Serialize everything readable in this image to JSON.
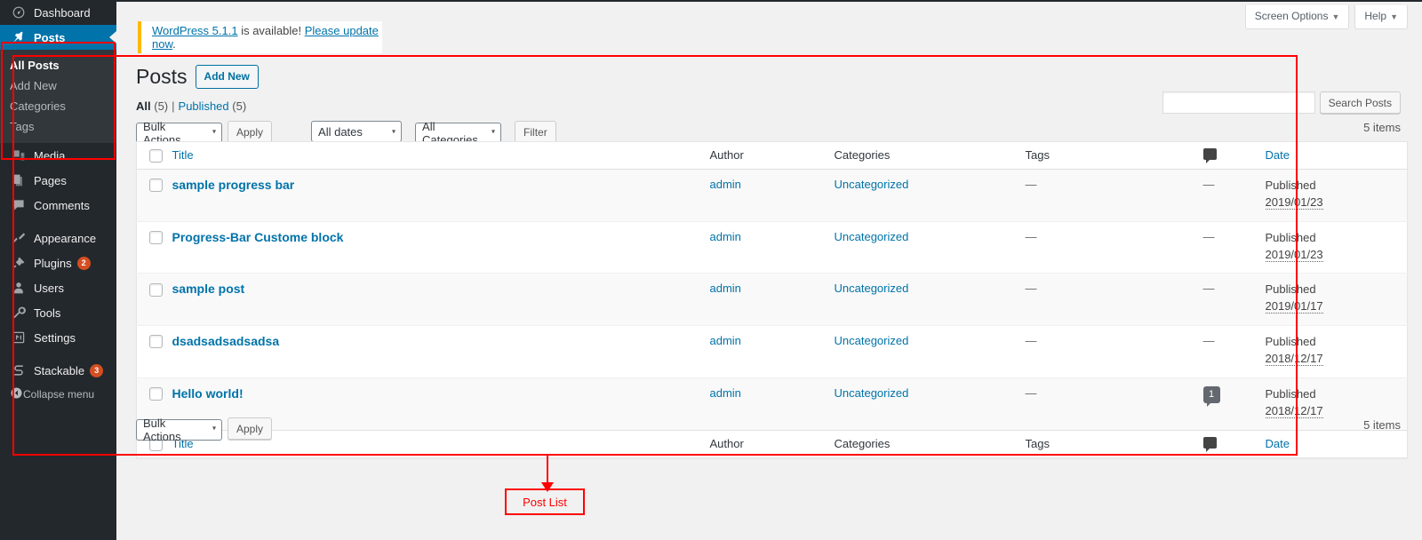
{
  "sidebar": {
    "items": [
      {
        "label": "Dashboard",
        "icon": "dashboard-icon",
        "current": false
      },
      {
        "label": "Posts",
        "icon": "pin-icon",
        "current": true
      },
      {
        "label": "Media",
        "icon": "media-icon",
        "current": false
      },
      {
        "label": "Pages",
        "icon": "pages-icon",
        "current": false
      },
      {
        "label": "Comments",
        "icon": "comments-icon",
        "current": false
      },
      {
        "label": "Appearance",
        "icon": "brush-icon",
        "current": false
      },
      {
        "label": "Plugins",
        "icon": "plugin-icon",
        "current": false,
        "badge": "2"
      },
      {
        "label": "Users",
        "icon": "user-icon",
        "current": false
      },
      {
        "label": "Tools",
        "icon": "wrench-icon",
        "current": false
      },
      {
        "label": "Settings",
        "icon": "settings-icon",
        "current": false
      },
      {
        "label": "Stackable",
        "icon": "stackable-icon",
        "current": false,
        "badge": "3"
      }
    ],
    "submenu": [
      {
        "label": "All Posts",
        "current": true
      },
      {
        "label": "Add New",
        "current": false
      },
      {
        "label": "Categories",
        "current": false
      },
      {
        "label": "Tags",
        "current": false
      }
    ],
    "collapse": {
      "label": "Collapse menu",
      "icon": "collapse-icon"
    }
  },
  "screen_meta": {
    "screen_options": "Screen Options",
    "help": "Help",
    "caret": "▼"
  },
  "notice": {
    "link_version": "WordPress 5.1.1",
    "middle": " is available! ",
    "link_update": "Please update now",
    "end": "."
  },
  "header": {
    "title": "Posts",
    "add_new": "Add New"
  },
  "views": {
    "all_label": "All",
    "all_count": "(5)",
    "divider": "|",
    "published_label": "Published",
    "published_count": "(5)"
  },
  "search": {
    "value": "",
    "placeholder": "",
    "button": "Search Posts"
  },
  "tablenav": {
    "bulk_actions": "Bulk Actions",
    "apply": "Apply",
    "all_dates": "All dates",
    "all_categories": "All Categories",
    "filter": "Filter",
    "items_top": "5 items",
    "items_bottom": "5 items",
    "bulk_actions_bottom": "Bulk Actions",
    "apply_bottom": "Apply",
    "caret": "▾"
  },
  "table": {
    "columns": {
      "title": "Title",
      "author": "Author",
      "categories": "Categories",
      "tags": "Tags",
      "comments": "comments-bubble-icon",
      "date": "Date"
    },
    "rows": [
      {
        "title": "sample progress bar",
        "author": "admin",
        "categories": "Uncategorized",
        "tags": "—",
        "comments": "—",
        "comment_count": null,
        "date_status": "Published",
        "date_value": "2019/01/23"
      },
      {
        "title": "Progress-Bar Custome block",
        "author": "admin",
        "categories": "Uncategorized",
        "tags": "—",
        "comments": "—",
        "comment_count": null,
        "date_status": "Published",
        "date_value": "2019/01/23"
      },
      {
        "title": "sample post",
        "author": "admin",
        "categories": "Uncategorized",
        "tags": "—",
        "comments": "—",
        "comment_count": null,
        "date_status": "Published",
        "date_value": "2019/01/17"
      },
      {
        "title": "dsadsadsadsadsa",
        "author": "admin",
        "categories": "Uncategorized",
        "tags": "—",
        "comments": "—",
        "comment_count": null,
        "date_status": "Published",
        "date_value": "2018/12/17"
      },
      {
        "title": "Hello world!",
        "author": "admin",
        "categories": "Uncategorized",
        "tags": "—",
        "comments": null,
        "comment_count": "1",
        "date_status": "Published",
        "date_value": "2018/12/17"
      }
    ]
  },
  "annotation": {
    "label": "Post List",
    "color": "#ff0000"
  },
  "colors": {
    "sidebar_bg": "#23282d",
    "submenu_bg": "#32373c",
    "accent_blue": "#0073aa",
    "link_blue": "#0073aa",
    "notice_border": "#ffb900",
    "badge_orange": "#d54e21",
    "annotation_red": "#ff0000"
  }
}
